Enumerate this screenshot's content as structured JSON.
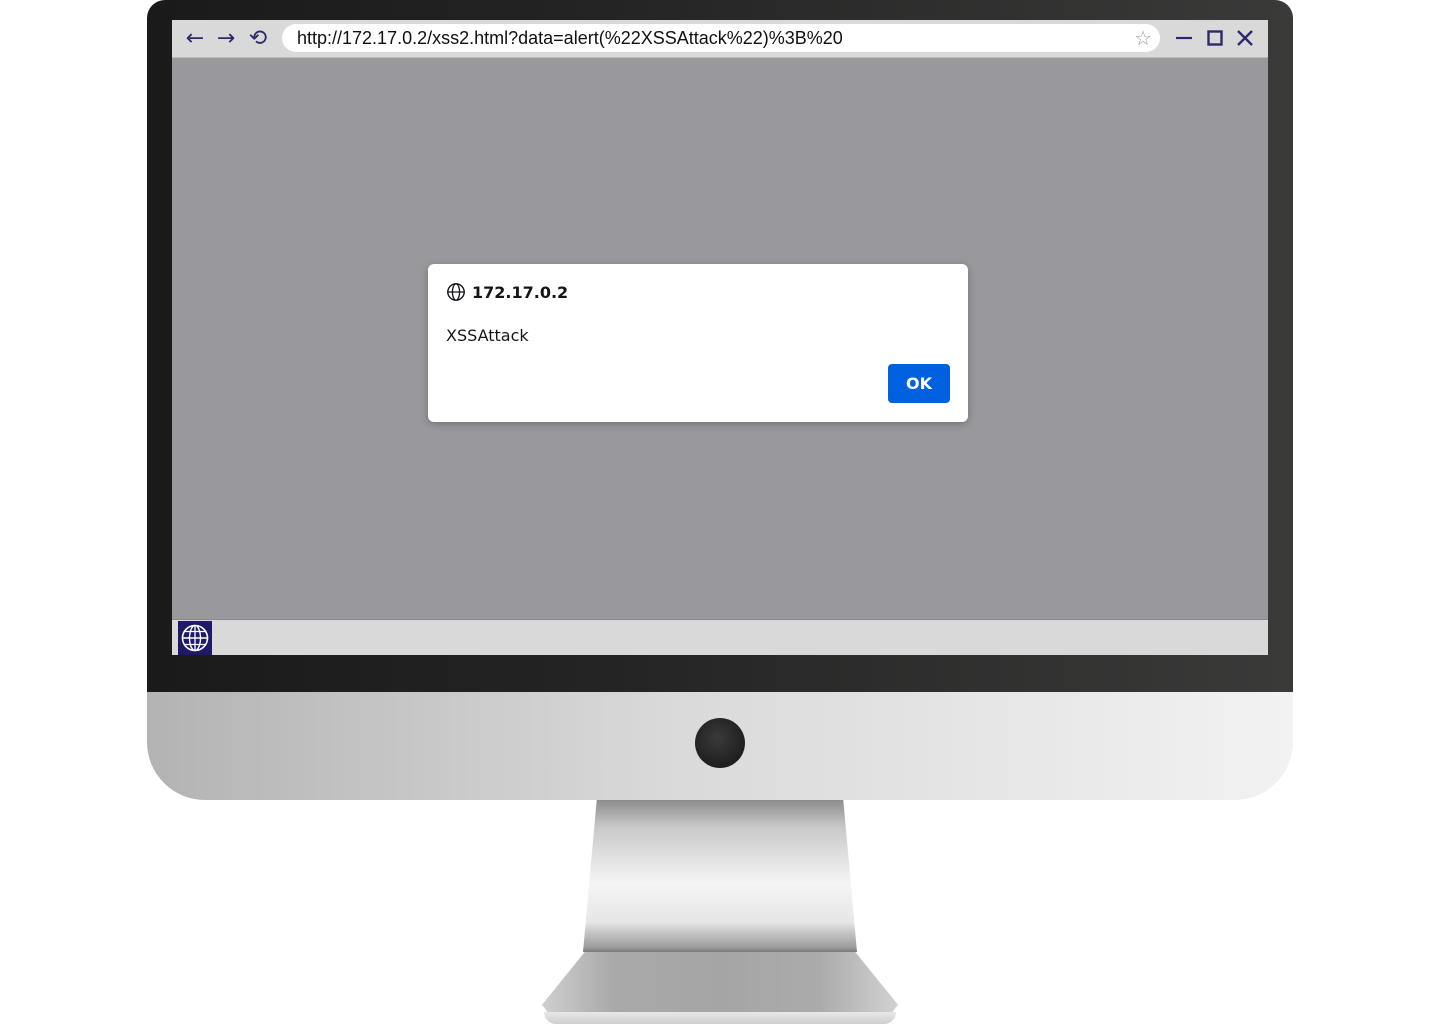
{
  "browser": {
    "url": "http://172.17.0.2/xss2.html?data=alert(%22XSSAttack%22)%3B%20",
    "back_icon": "←",
    "forward_icon": "→",
    "reload_icon": "⟲",
    "bookmark_icon": "☆"
  },
  "dialog": {
    "origin": "172.17.0.2",
    "message": "XSSAttack",
    "ok_label": "OK"
  },
  "colors": {
    "accent": "#0061e0",
    "toolbar_icons": "#2d2a6b",
    "page_overlay": "#98989d",
    "launcher": "#1f1a68"
  },
  "icons": [
    "back-arrow-icon",
    "forward-arrow-icon",
    "reload-icon",
    "star-icon",
    "minimize-icon",
    "maximize-icon",
    "close-icon",
    "globe-icon"
  ]
}
